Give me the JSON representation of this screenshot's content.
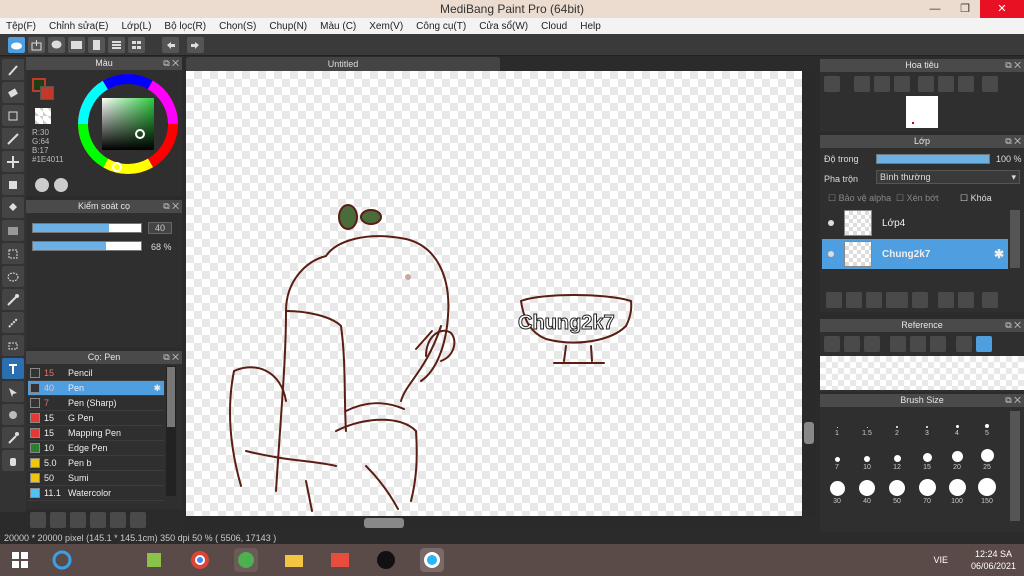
{
  "window": {
    "title": "MediBang Paint Pro (64bit)"
  },
  "menu": [
    "Tệp(F)",
    "Chỉnh sửa(E)",
    "Lớp(L)",
    "Bộ lọc(R)",
    "Chọn(S)",
    "Chụp(N)",
    "Màu (C)",
    "Xem(V)",
    "Công cụ(T)",
    "Cửa sổ(W)",
    "Cloud",
    "Help"
  ],
  "color_panel": {
    "title": "Màu",
    "rgb": [
      "R:30",
      "G:64",
      "B:17"
    ],
    "hex": "#1E4011",
    "primary_color": "#1e4011",
    "secondary_color": "#c0392b"
  },
  "control_panel": {
    "title": "Kiểm soát cọ",
    "size_value": "40",
    "opacity_value": "68 %",
    "size_fill": 0.7,
    "opacity_fill": 0.68
  },
  "pen_panel": {
    "title": "Cọ: Pen",
    "brushes": [
      {
        "size": "15",
        "name": "Pencil",
        "color": "#333333"
      },
      {
        "size": "40",
        "name": "Pen",
        "color": "#333333",
        "selected": true
      },
      {
        "size": "7",
        "name": "Pen (Sharp)",
        "color": "#333333"
      },
      {
        "size": "15",
        "name": "G Pen",
        "color": "#e53935"
      },
      {
        "size": "15",
        "name": "Mapping Pen",
        "color": "#e53935"
      },
      {
        "size": "10",
        "name": "Edge Pen",
        "color": "#2e7d32"
      },
      {
        "size": "5.0",
        "name": "Pen b",
        "color": "#f1c40f"
      },
      {
        "size": "50",
        "name": "Sumi",
        "color": "#f1c40f"
      },
      {
        "size": "11.1",
        "name": "Watercolor",
        "color": "#4fc3f7"
      }
    ]
  },
  "canvas": {
    "tab_title": "Untitled",
    "text_art": "Chung2k7"
  },
  "status": {
    "text": "20000 * 20000 pixel  (145.1 * 145.1cm)  350 dpi  50 %  ( 5506, 17143 )"
  },
  "navigator": {
    "title": "Hoa tiêu"
  },
  "layer_panel": {
    "title": "Lớp",
    "opacity_label": "Độ trong",
    "opacity_value": "100 %",
    "blend_label": "Pha trộn",
    "blend_value": "Bình thường",
    "protect_alpha": "Bảo vệ alpha",
    "clipping": "Xén bớt",
    "lock": "Khóa",
    "layers": [
      {
        "name": "Lớp4",
        "selected": false
      },
      {
        "name": "Chung2k7",
        "selected": true
      }
    ]
  },
  "reference": {
    "title": "Reference"
  },
  "brush_size": {
    "title": "Brush Size",
    "sizes": [
      "1",
      "1.5",
      "2",
      "3",
      "4",
      "5",
      "7",
      "10",
      "12",
      "15",
      "20",
      "25",
      "30",
      "40",
      "50",
      "70",
      "100",
      "150"
    ]
  },
  "taskbar": {
    "time": "12:24 SA",
    "date": "06/06/2021",
    "lang": "VIE"
  }
}
